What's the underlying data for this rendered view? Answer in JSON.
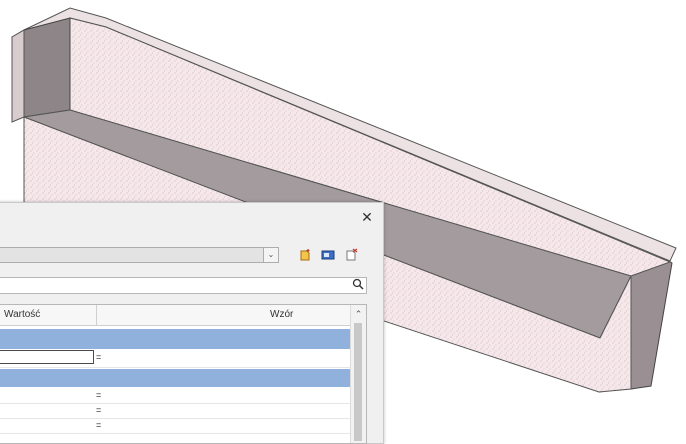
{
  "dialog": {
    "close_symbol": "✕",
    "combo_arrow": "⌄",
    "toolbar_icons": [
      "new-parameter-icon",
      "edit-parameter-icon",
      "delete-parameter-icon"
    ],
    "search_symbol": "🔍"
  },
  "table": {
    "columns": [
      "Wartość",
      "Wzór"
    ],
    "rows": [
      {
        "kind": "group"
      },
      {
        "kind": "param",
        "value": "",
        "formula": "="
      },
      {
        "kind": "group"
      },
      {
        "kind": "param",
        "value": "",
        "formula": "="
      },
      {
        "kind": "param",
        "value": "",
        "formula": "="
      },
      {
        "kind": "param",
        "value": "",
        "formula": "="
      }
    ],
    "scroll_up_symbol": "⌃"
  },
  "colors": {
    "beam_face": "#f4e6e8",
    "beam_inner": "#a9a1a4",
    "group_row": "#8fb1db"
  }
}
